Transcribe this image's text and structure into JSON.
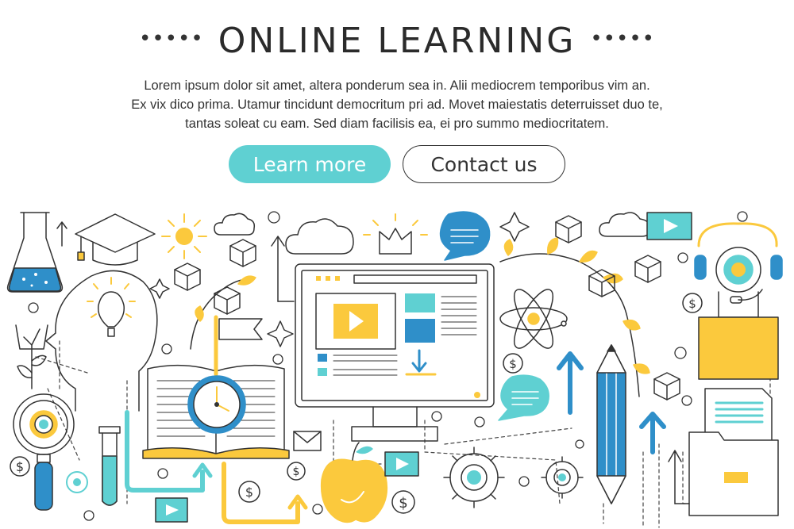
{
  "header": {
    "dots_left": "•••••",
    "title": "ONLINE LEARNING",
    "dots_right": "•••••",
    "description_lines": [
      "Lorem ipsum dolor sit amet, altera ponderum sea in. Alii mediocrem temporibus vim an.",
      "Ex vix dico prima. Utamur tincidunt democritum pri ad. Movet maiestatis deterruisset duo te,",
      "tantas soleat cu eam. Sed diam facilisis ea, ei pro summo mediocritatem."
    ]
  },
  "buttons": {
    "learn_more": "Learn more",
    "contact_us": "Contact us"
  },
  "illustration": {
    "dollar_symbol": "$",
    "colors": {
      "teal": "#5fd0d2",
      "blue": "#2f8fc9",
      "yellow": "#fbc93d",
      "outline": "#333333"
    }
  }
}
